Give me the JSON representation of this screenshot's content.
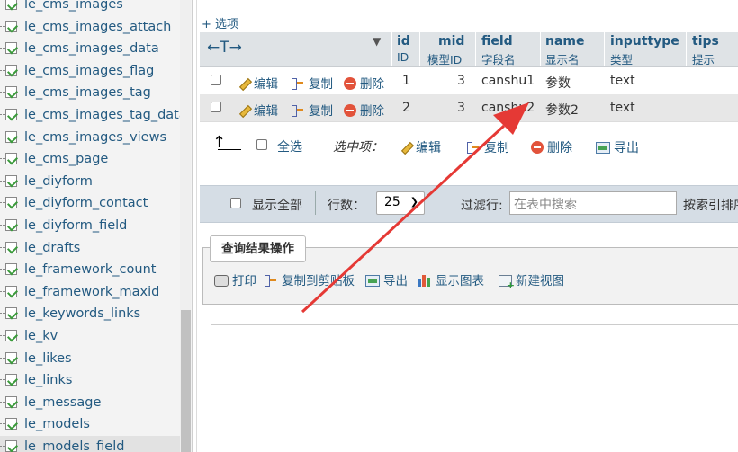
{
  "sidebar": {
    "items": [
      {
        "label": "le_cms_images"
      },
      {
        "label": "le_cms_images_attach"
      },
      {
        "label": "le_cms_images_data"
      },
      {
        "label": "le_cms_images_flag"
      },
      {
        "label": "le_cms_images_tag"
      },
      {
        "label": "le_cms_images_tag_data"
      },
      {
        "label": "le_cms_images_views"
      },
      {
        "label": "le_cms_page"
      },
      {
        "label": "le_diyform"
      },
      {
        "label": "le_diyform_contact"
      },
      {
        "label": "le_diyform_field"
      },
      {
        "label": "le_drafts"
      },
      {
        "label": "le_framework_count"
      },
      {
        "label": "le_framework_maxid"
      },
      {
        "label": "le_keywords_links"
      },
      {
        "label": "le_kv"
      },
      {
        "label": "le_likes"
      },
      {
        "label": "le_links"
      },
      {
        "label": "le_message"
      },
      {
        "label": "le_models"
      },
      {
        "label": "le_models_field"
      }
    ],
    "selected": "le_models_field"
  },
  "main": {
    "options_link": "+ 选项",
    "sort_arrows": "←T→",
    "sort_dropdown": "▼",
    "columns": [
      {
        "name": "id",
        "comment": "ID"
      },
      {
        "name": "mid",
        "comment": "模型ID"
      },
      {
        "name": "field",
        "comment": "字段名"
      },
      {
        "name": "name",
        "comment": "显示名"
      },
      {
        "name": "inputtype",
        "comment": "类型"
      },
      {
        "name": "tips",
        "comment": "提示"
      }
    ],
    "row_actions": {
      "edit": "编辑",
      "copy": "复制",
      "delete": "删除"
    },
    "rows": [
      {
        "id": "1",
        "mid": "3",
        "field": "canshu1",
        "name": "参数",
        "inputtype": "text"
      },
      {
        "id": "2",
        "mid": "3",
        "field": "canshu2",
        "name": "参数2",
        "inputtype": "text"
      }
    ],
    "bulk": {
      "up_arrow": "↑",
      "select_all": "全选",
      "with_selected": "选中项：",
      "edit": "编辑",
      "copy": "复制",
      "delete": "删除",
      "export": "导出"
    },
    "filter": {
      "show_all": "显示全部",
      "rows_label": "行数：",
      "rows_value": "25",
      "filter_label": "过滤行:",
      "filter_placeholder": "在表中搜索",
      "sort_by_index": "按索引排序"
    },
    "query_ops": {
      "legend": "查询结果操作",
      "print": "打印",
      "copy_clipboard": "复制到剪贴板",
      "export": "导出",
      "show_chart": "显示图表",
      "create_view": "新建视图"
    }
  },
  "colors": {
    "link": "#235a81",
    "annotation_arrow": "#e53935"
  }
}
